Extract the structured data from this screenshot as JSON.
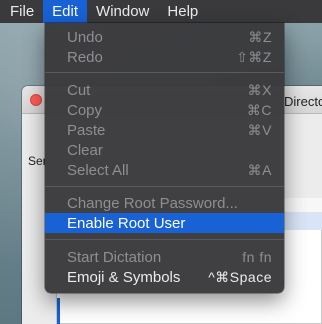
{
  "menubar": {
    "items": [
      "File",
      "Edit",
      "Window",
      "Help"
    ],
    "active": "Edit"
  },
  "background_window": {
    "title_fragment": "Directo",
    "toolbar_fragment": "Ser"
  },
  "edit_menu": {
    "items": [
      {
        "label": "Undo",
        "shortcut": "⌘Z",
        "enabled": false
      },
      {
        "label": "Redo",
        "shortcut": "⇧⌘Z",
        "enabled": false
      },
      {
        "label": "Cut",
        "shortcut": "⌘X",
        "enabled": false
      },
      {
        "label": "Copy",
        "shortcut": "⌘C",
        "enabled": false
      },
      {
        "label": "Paste",
        "shortcut": "⌘V",
        "enabled": false
      },
      {
        "label": "Clear",
        "shortcut": "",
        "enabled": false
      },
      {
        "label": "Select All",
        "shortcut": "⌘A",
        "enabled": false
      },
      {
        "label": "Change Root Password...",
        "shortcut": "",
        "enabled": false
      },
      {
        "label": "Enable Root User",
        "shortcut": "",
        "enabled": true,
        "highlighted": true
      },
      {
        "label": "Start Dictation",
        "shortcut": "fn fn",
        "enabled": false
      },
      {
        "label": "Emoji & Symbols",
        "shortcut": "^⌘Space",
        "enabled": true
      }
    ]
  },
  "colors": {
    "menubar_bg": "#3a3a3c",
    "menu_bg": "#3a3a3c",
    "highlight": "#1862d6",
    "disabled_text": "#8e8e93",
    "enabled_text": "#ececec"
  }
}
